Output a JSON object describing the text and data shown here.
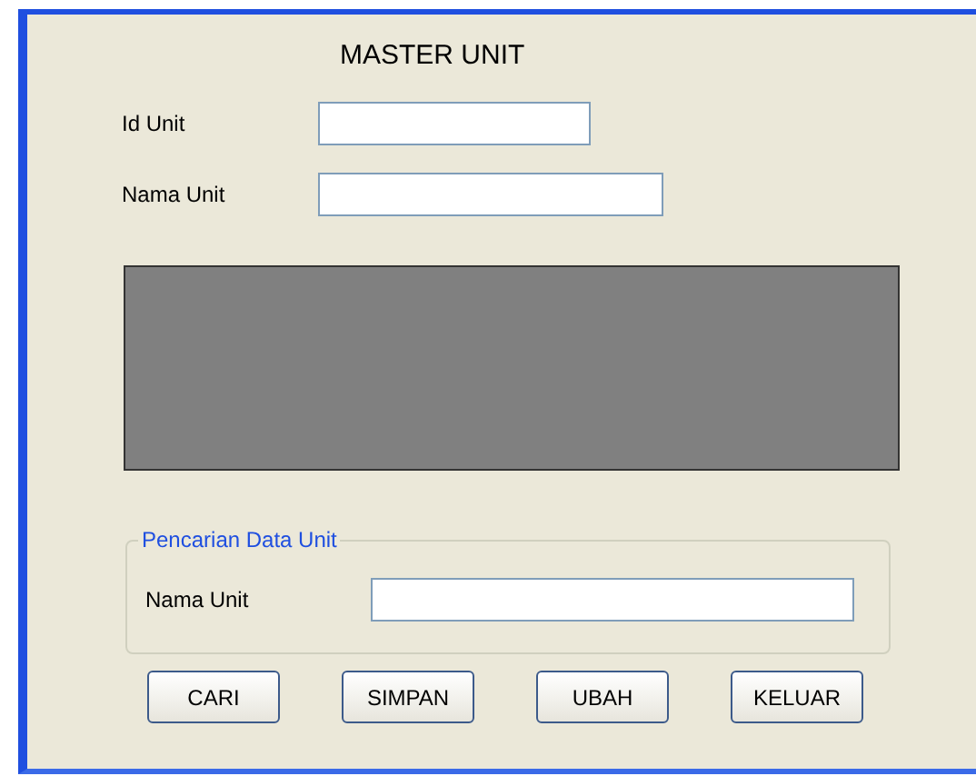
{
  "form": {
    "title": "MASTER UNIT"
  },
  "fields": [
    {
      "label": "Id Unit"
    },
    {
      "label": "Nama Unit"
    }
  ],
  "search_group": {
    "legend": "Pencarian Data Unit",
    "fields": [
      {
        "label": "Nama Unit"
      }
    ]
  },
  "buttons": [
    "CARI",
    "SIMPAN",
    "UBAH",
    "KELUAR"
  ]
}
